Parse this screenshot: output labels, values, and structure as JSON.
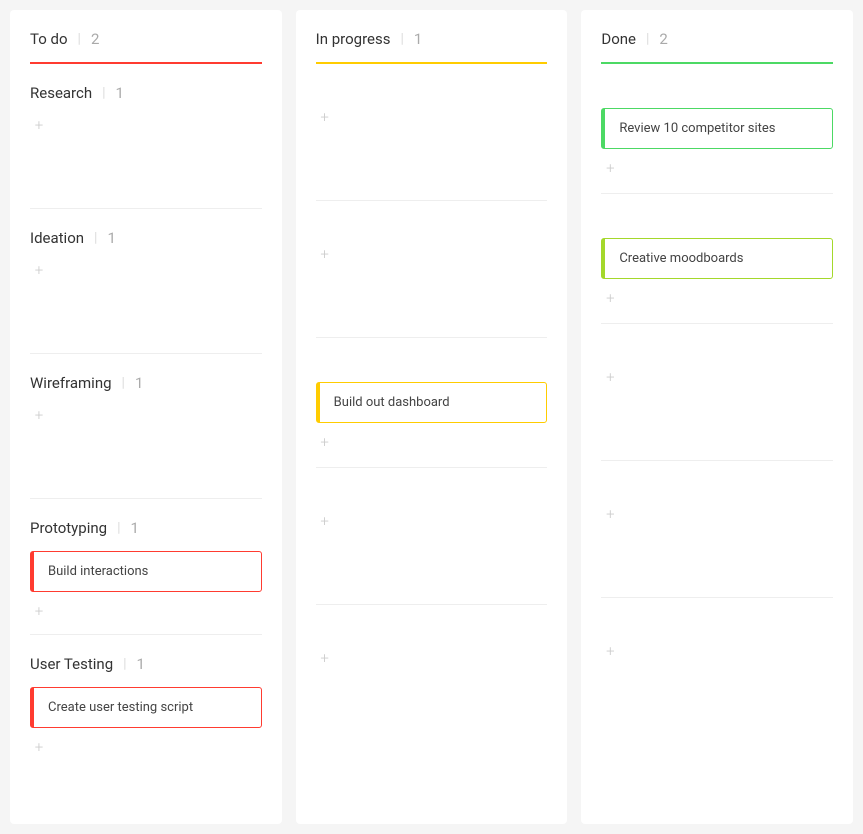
{
  "columns": {
    "todo": {
      "title": "To do",
      "count": 2,
      "color": "#ff3b30"
    },
    "inprogress": {
      "title": "In progress",
      "count": 1,
      "color": "#ffcc00"
    },
    "done": {
      "title": "Done",
      "count": 2,
      "color": "#4cd964"
    }
  },
  "lanes": {
    "research": {
      "title": "Research",
      "count": 1
    },
    "ideation": {
      "title": "Ideation",
      "count": 1
    },
    "wireframing": {
      "title": "Wireframing",
      "count": 1
    },
    "prototyping": {
      "title": "Prototyping",
      "count": 1
    },
    "usertesting": {
      "title": "User Testing",
      "count": 1
    }
  },
  "cards": {
    "review_competitors": {
      "title": "Review 10 competitor sites"
    },
    "creative_moodboards": {
      "title": "Creative moodboards"
    },
    "build_dashboard": {
      "title": "Build out dashboard"
    },
    "build_interactions": {
      "title": "Build interactions"
    },
    "user_testing_script": {
      "title": "Create user testing script"
    }
  },
  "icons": {
    "plus": "+"
  },
  "separator": "|"
}
